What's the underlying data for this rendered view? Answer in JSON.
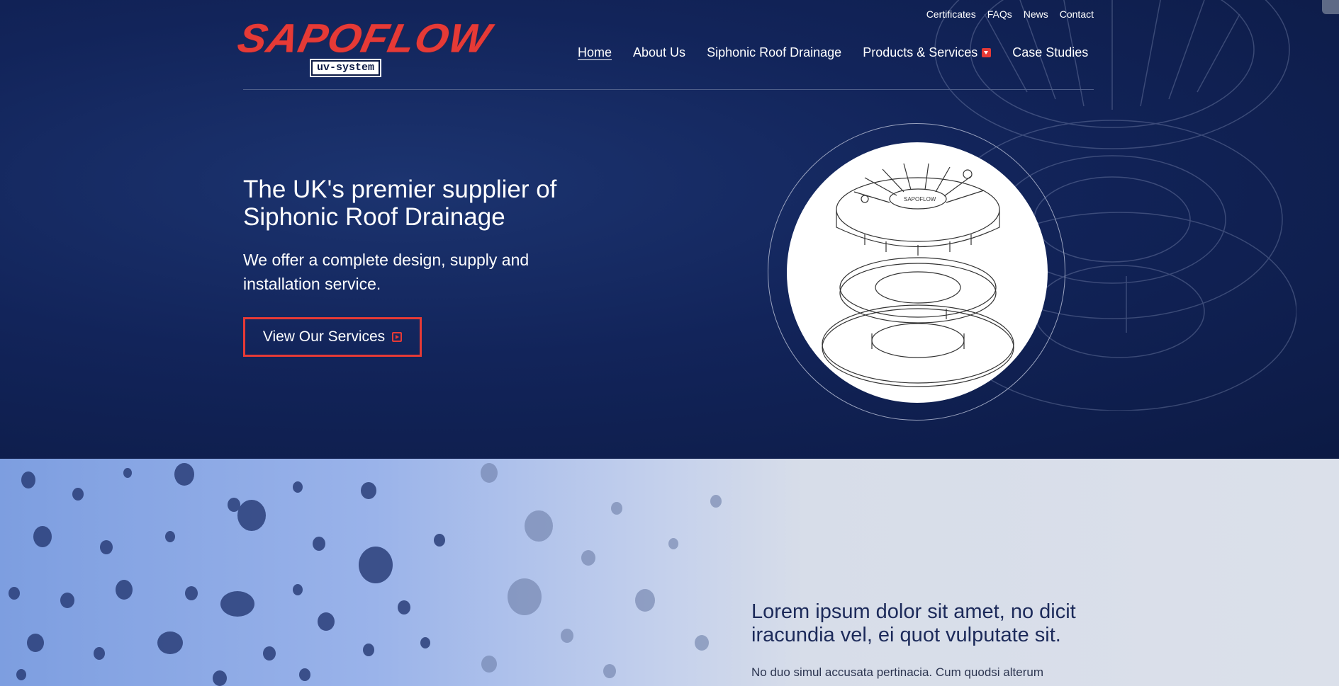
{
  "topbar": {
    "links": [
      "Certificates",
      "FAQs",
      "News",
      "Contact"
    ]
  },
  "logo": {
    "wordmark": "SAPOFLOW",
    "badge": "uv-system"
  },
  "nav": {
    "items": [
      "Home",
      "About Us",
      "Siphonic Roof Drainage",
      "Products & Services",
      "Case Studies"
    ],
    "active": "Home"
  },
  "hero": {
    "headline": "The UK's premier supplier of Siphonic Roof Drainage",
    "subline": "We offer a complete design, supply and installation service.",
    "cta_label": "View Our Services",
    "product_badge": "SAPOFLOW"
  },
  "lower": {
    "title": "Lorem ipsum dolor sit amet, no dicit iracundia vel, ei quot vulputate sit.",
    "text": "No duo simul accusata pertinacia. Cum quodsi alterum"
  },
  "colors": {
    "navy": "#0f1e4a",
    "accent_red": "#e63a36",
    "light_section": "#dbe0ea"
  },
  "icons": [
    "chevron-down-icon",
    "play-icon"
  ]
}
